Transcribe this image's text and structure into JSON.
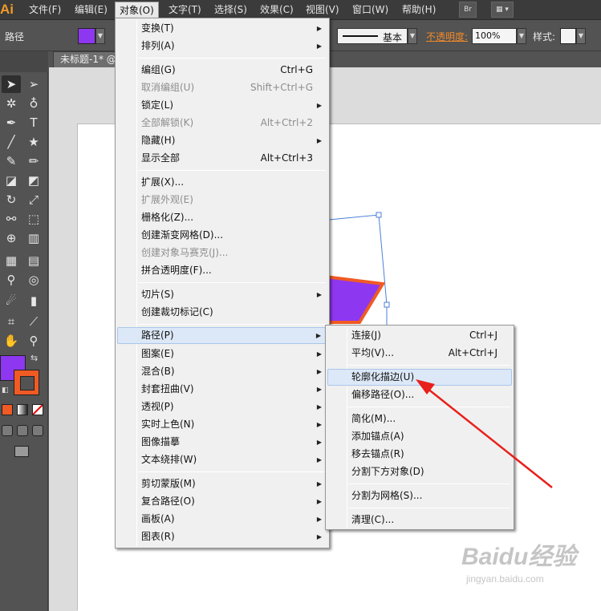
{
  "menubar": {
    "logo": "Ai",
    "items": [
      {
        "label": "文件(F)"
      },
      {
        "label": "编辑(E)"
      },
      {
        "label": "对象(O)"
      },
      {
        "label": "文字(T)"
      },
      {
        "label": "选择(S)"
      },
      {
        "label": "效果(C)"
      },
      {
        "label": "视图(V)"
      },
      {
        "label": "窗口(W)"
      },
      {
        "label": "帮助(H)"
      }
    ],
    "bridge_label": "Br",
    "active_menu": "对象(O)"
  },
  "controlbar": {
    "selection_type": "路径",
    "fill_color": "#8e37f0",
    "stroke_style_label": "基本",
    "opacity_label": "不透明度:",
    "opacity_value": "100%",
    "style_label": "样式:"
  },
  "document": {
    "tab_title": "未标题-1* @"
  },
  "toolbox": {
    "fill_color": "#8e37f0",
    "stroke_color": "#f05a24"
  },
  "object_menu": {
    "items": [
      {
        "label": "变换(T)",
        "submenu": true
      },
      {
        "label": "排列(A)",
        "submenu": true
      },
      {
        "label": "编组(G)",
        "shortcut": "Ctrl+G"
      },
      {
        "label": "取消编组(U)",
        "shortcut": "Shift+Ctrl+G",
        "disabled": true
      },
      {
        "label": "锁定(L)",
        "submenu": true
      },
      {
        "label": "全部解锁(K)",
        "shortcut": "Alt+Ctrl+2",
        "disabled": true
      },
      {
        "label": "隐藏(H)",
        "submenu": true
      },
      {
        "label": "显示全部",
        "shortcut": "Alt+Ctrl+3"
      },
      {
        "label": "扩展(X)..."
      },
      {
        "label": "扩展外观(E)",
        "disabled": true
      },
      {
        "label": "栅格化(Z)..."
      },
      {
        "label": "创建渐变网格(D)..."
      },
      {
        "label": "创建对象马赛克(J)...",
        "disabled": true
      },
      {
        "label": "拼合透明度(F)..."
      },
      {
        "label": "切片(S)",
        "submenu": true
      },
      {
        "label": "创建裁切标记(C)"
      },
      {
        "label": "路径(P)",
        "submenu": true,
        "highlighted": true
      },
      {
        "label": "图案(E)",
        "submenu": true
      },
      {
        "label": "混合(B)",
        "submenu": true
      },
      {
        "label": "封套扭曲(V)",
        "submenu": true
      },
      {
        "label": "透视(P)",
        "submenu": true
      },
      {
        "label": "实时上色(N)",
        "submenu": true
      },
      {
        "label": "图像描摹",
        "submenu": true
      },
      {
        "label": "文本绕排(W)",
        "submenu": true
      },
      {
        "label": "剪切蒙版(M)",
        "submenu": true
      },
      {
        "label": "复合路径(O)",
        "submenu": true
      },
      {
        "label": "画板(A)",
        "submenu": true
      },
      {
        "label": "图表(R)",
        "submenu": true
      }
    ]
  },
  "path_submenu": {
    "items": [
      {
        "label": "连接(J)",
        "shortcut": "Ctrl+J"
      },
      {
        "label": "平均(V)...",
        "shortcut": "Alt+Ctrl+J"
      },
      {
        "label": "轮廓化描边(U)",
        "highlighted": true
      },
      {
        "label": "偏移路径(O)..."
      },
      {
        "label": "简化(M)..."
      },
      {
        "label": "添加锚点(A)"
      },
      {
        "label": "移去锚点(R)"
      },
      {
        "label": "分割下方对象(D)"
      },
      {
        "label": "分割为网格(S)..."
      },
      {
        "label": "清理(C)..."
      }
    ]
  },
  "watermark": {
    "brand": "Baidu经验",
    "url": "jingyan.baidu.com"
  },
  "annotation": {
    "arrow_color": "#e8201c"
  }
}
